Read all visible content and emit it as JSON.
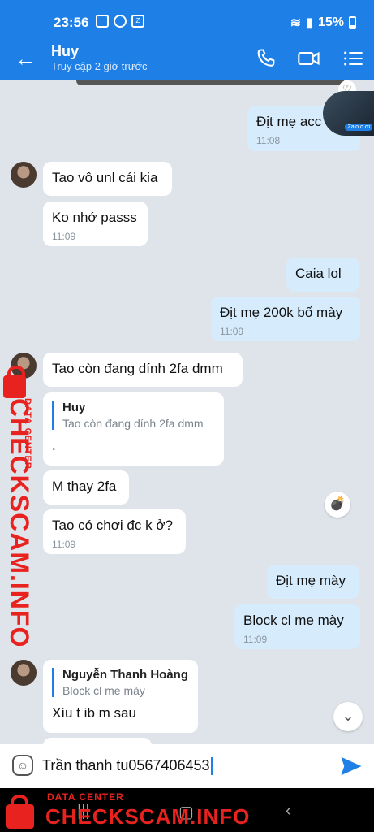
{
  "status_bar": {
    "time": "23:56",
    "battery": "15%"
  },
  "header": {
    "contact_name": "Huy",
    "last_seen": "Truy cập 2 giờ trước"
  },
  "messages": [
    {
      "dir": "out",
      "text": "Địt mẹ acc",
      "time": "11:08"
    },
    {
      "dir": "in",
      "text": "Tao vô unl cái kia"
    },
    {
      "dir": "in",
      "text": "Ko nhớ passs",
      "time": "11:09"
    },
    {
      "dir": "out",
      "text": "Caia lol"
    },
    {
      "dir": "out",
      "text": "Địt mẹ 200k bố mày",
      "time": "11:09"
    },
    {
      "dir": "in",
      "text": "Tao còn đang dính 2fa dmm"
    },
    {
      "dir": "in",
      "quote_name": "Huy",
      "quote_text": "Tao còn đang dính 2fa dmm",
      "text": "."
    },
    {
      "dir": "in",
      "text": "M thay 2fa"
    },
    {
      "dir": "in",
      "text": "Tao có chơi đc k ở?",
      "time": "11:09"
    },
    {
      "dir": "out",
      "text": "Địt mẹ mày"
    },
    {
      "dir": "out",
      "text": "Block cl me mày",
      "time": "11:09"
    },
    {
      "dir": "in",
      "quote_name": "Nguyễn Thanh Hoàng",
      "quote_text": "Block cl me mày",
      "text": "Xíu t ib m sau"
    }
  ],
  "floating_thumb_label": "Zalo o ơi",
  "input": {
    "value": "Trần thanh tu0567406453"
  },
  "watermark": {
    "small": "DATA CENTER",
    "big": "CHECKSCAM.INFO"
  },
  "colors": {
    "accent": "#1e7fe6",
    "outgoing_bubble": "#d6ecfd",
    "watermark": "#e8231f"
  }
}
